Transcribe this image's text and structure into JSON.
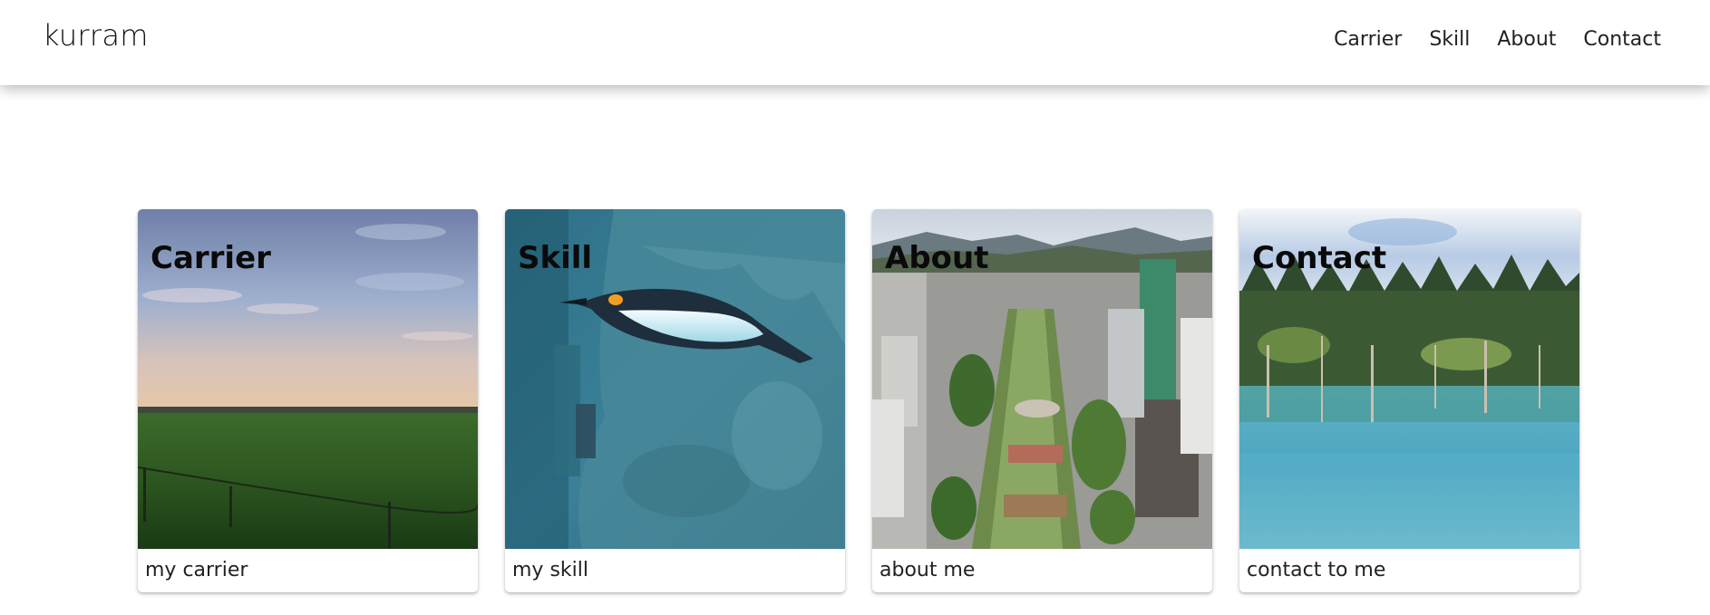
{
  "header": {
    "brand": "kurram",
    "nav": [
      {
        "label": "Carrier"
      },
      {
        "label": "Skill"
      },
      {
        "label": "About"
      },
      {
        "label": "Contact"
      }
    ]
  },
  "cards": [
    {
      "title": "Carrier",
      "caption": "my carrier"
    },
    {
      "title": "Skill",
      "caption": "my skill"
    },
    {
      "title": "About",
      "caption": "about me"
    },
    {
      "title": "Contact",
      "caption": "contact to me"
    }
  ]
}
